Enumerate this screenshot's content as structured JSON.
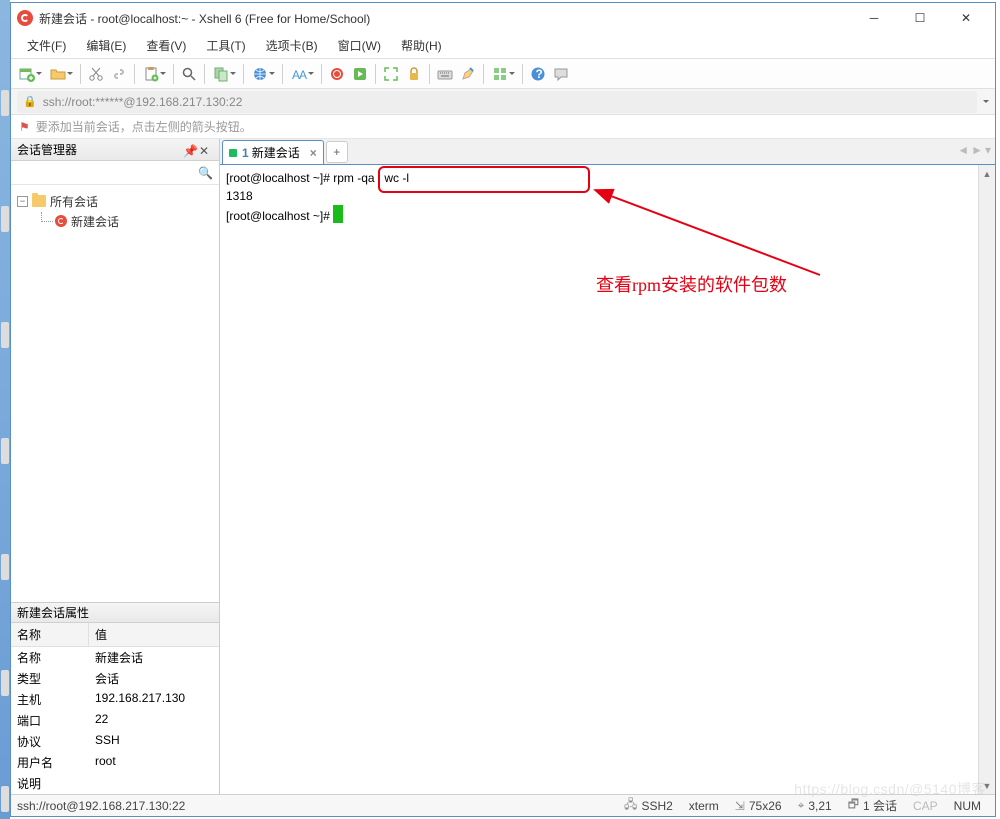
{
  "window": {
    "title": "新建会话 - root@localhost:~ - Xshell 6 (Free for Home/School)"
  },
  "menu": {
    "file": "文件(F)",
    "edit": "编辑(E)",
    "view": "查看(V)",
    "tools": "工具(T)",
    "tabs": "选项卡(B)",
    "window": "窗口(W)",
    "help": "帮助(H)"
  },
  "addressbar": {
    "value": "ssh://root:******@192.168.217.130:22"
  },
  "infobar": {
    "text": "要添加当前会话，点击左侧的箭头按钮。"
  },
  "sidebar": {
    "title": "会话管理器",
    "root": "所有会话",
    "session": "新建会话"
  },
  "props": {
    "title": "新建会话属性",
    "hdr_name": "名称",
    "hdr_value": "值",
    "rows": [
      {
        "k": "名称",
        "v": "新建会话"
      },
      {
        "k": "类型",
        "v": "会话"
      },
      {
        "k": "主机",
        "v": "192.168.217.130"
      },
      {
        "k": "端口",
        "v": "22"
      },
      {
        "k": "协议",
        "v": "SSH"
      },
      {
        "k": "用户名",
        "v": "root"
      },
      {
        "k": "说明",
        "v": ""
      }
    ]
  },
  "tab": {
    "num": "1",
    "label": "新建会话"
  },
  "terminal": {
    "line1": "[root@localhost ~]# rpm -qa | wc -l",
    "line2": "1318",
    "line3": "[root@localhost ~]# "
  },
  "annotation": "查看rpm安装的软件包数",
  "status": {
    "left": "ssh://root@192.168.217.130:22",
    "ssh": "SSH2",
    "term": "xterm",
    "size": "75x26",
    "pos": "3,21",
    "sess": "1 会话",
    "cap": "CAP",
    "num": "NUM"
  },
  "watermark": "https://blog.csdn/@5140博客"
}
